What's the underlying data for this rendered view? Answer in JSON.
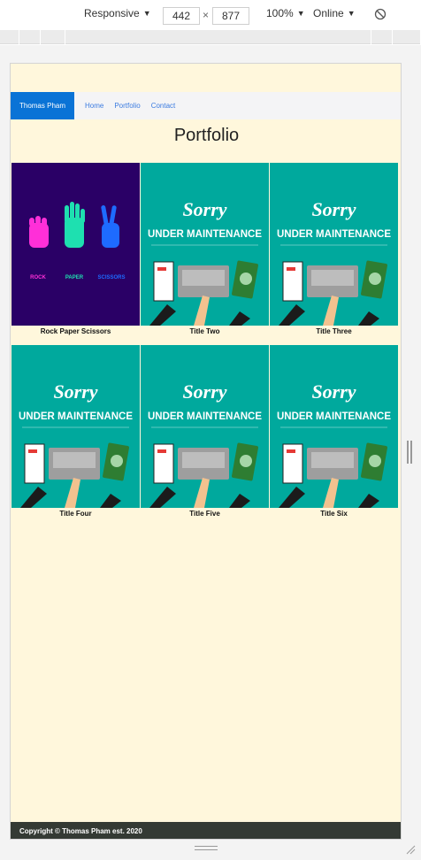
{
  "devtools": {
    "device": "Responsive",
    "width": "442",
    "times": "×",
    "height": "877",
    "zoom": "100%",
    "throttle": "Online"
  },
  "site": {
    "brand": "Thomas Pham",
    "nav": [
      "Home",
      "Portfolio",
      "Contact"
    ],
    "title": "Portfolio",
    "cards": [
      {
        "caption": "Rock Paper Scissors",
        "image": "rps"
      },
      {
        "caption": "Title Two",
        "image": "maintenance"
      },
      {
        "caption": "Title Three",
        "image": "maintenance"
      },
      {
        "caption": "Title Four",
        "image": "maintenance"
      },
      {
        "caption": "Title Five",
        "image": "maintenance"
      },
      {
        "caption": "Title Six",
        "image": "maintenance"
      }
    ],
    "maintenance": {
      "line1": "Sorry",
      "line2": "UNDER MAINTENANCE"
    },
    "rps": {
      "rock": "ROCK",
      "paper": "PAPER",
      "scissors": "SCISSORS"
    },
    "footer": "Copyright © Thomas Pham est. 2020"
  },
  "colors": {
    "page_bg": "#fff7dc",
    "brand_bg": "#0a73d6",
    "teal": "#00a99d",
    "rps_bg": "#2a0066",
    "footer_bg": "#343a34"
  }
}
